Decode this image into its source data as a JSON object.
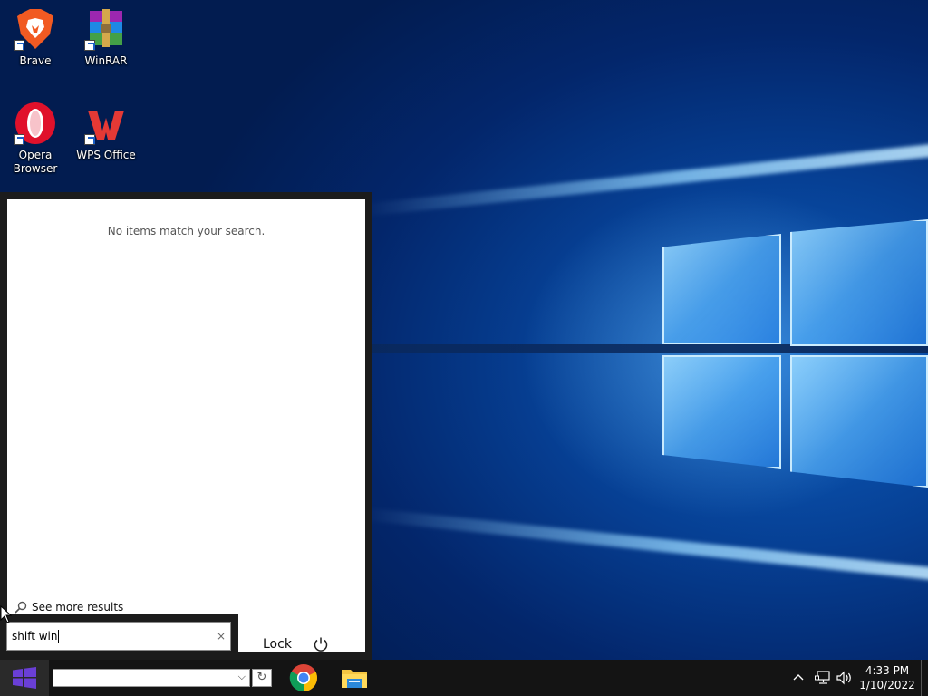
{
  "desktop": {
    "icons": [
      {
        "label": "Brave",
        "icon": "brave-icon"
      },
      {
        "label": "WinRAR",
        "icon": "winrar-icon"
      },
      {
        "label": "Opera Browser",
        "icon": "opera-icon"
      },
      {
        "label": "WPS Office",
        "icon": "wps-office-icon"
      }
    ]
  },
  "start_menu": {
    "empty_message": "No items match your search.",
    "see_more_label": "See more results",
    "search": {
      "value": "shift win",
      "clear_glyph": "×"
    },
    "lock_label": "Lock",
    "power_icon": "power-icon"
  },
  "taskbar": {
    "start_icon": "windows-start-icon",
    "address_value": "",
    "address_dropdown_glyph": "⌵",
    "refresh_glyph": "↻",
    "pinned": [
      {
        "name": "Google Chrome",
        "icon": "chrome-icon"
      },
      {
        "name": "File Explorer",
        "icon": "file-explorer-icon"
      }
    ],
    "tray": {
      "chevron_icon": "chevron-up-icon",
      "network_icon": "network-icon",
      "volume_icon": "volume-icon",
      "time": "4:33 PM",
      "date": "1/10/2022"
    }
  },
  "colors": {
    "taskbar": "#141414",
    "panel": "#1c1c1c",
    "start_accent": "#6a3fd6",
    "wallpaper": "#063f93"
  }
}
